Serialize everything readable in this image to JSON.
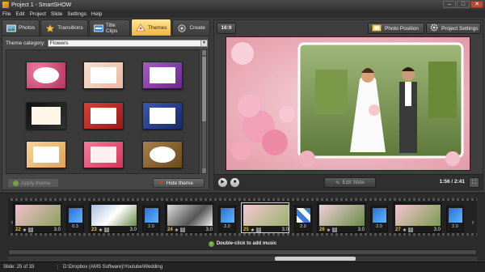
{
  "window": {
    "title": "Project 1 - SmartSHOW",
    "minimize": "–",
    "maximize": "□",
    "close": "✕"
  },
  "menu": [
    "File",
    "Edit",
    "Project",
    "Slide",
    "Settings",
    "Help"
  ],
  "tabs": [
    {
      "label": "Photos",
      "icon": "photos-icon"
    },
    {
      "label": "Transitions",
      "icon": "star-icon"
    },
    {
      "label": "Title Clips",
      "icon": "title-clips-icon"
    },
    {
      "label": "Themes",
      "icon": "themes-icon",
      "active": true
    },
    {
      "label": "Create",
      "icon": "create-icon"
    }
  ],
  "themes_panel": {
    "category_label": "Theme category:",
    "category_value": "Flowers",
    "apply_label": "Apply theme",
    "hide_label": "Hide theme",
    "thumbnails": [
      {
        "name": "pink-roses-oval",
        "bg": "#b3355a",
        "inner": "#ffffff"
      },
      {
        "name": "cream-flower-frame",
        "bg": "#f1d2c2",
        "inner": "#ffffff"
      },
      {
        "name": "purple-floral-frame",
        "bg": "#7a3b9a",
        "inner": "#ffffff"
      },
      {
        "name": "blossom-corner-frame",
        "bg": "#1e1e1e",
        "inner": "#fdf6e8"
      },
      {
        "name": "red-roses-frame",
        "bg": "#c0302e",
        "inner": "#ffffff"
      },
      {
        "name": "blue-floral-frame",
        "bg": "#2b3d8a",
        "inner": "#ffffff"
      },
      {
        "name": "peach-flowers-frame",
        "bg": "#f0c48a",
        "inner": "#ffffff"
      },
      {
        "name": "pink-lily-frame",
        "bg": "#e6547c",
        "inner": "#fff0f0"
      },
      {
        "name": "golden-oval-frame",
        "bg": "#8a6a3a",
        "inner": "#ffffff"
      }
    ]
  },
  "preview": {
    "aspect_label": "16:9",
    "photo_position_label": "Photo Position",
    "project_settings_label": "Project Settings",
    "edit_slide_label": "Edit Slide",
    "time": "1:56 / 2:41"
  },
  "timeline": {
    "slides": [
      {
        "num": "22",
        "duration": "3.0"
      },
      {
        "num": "23",
        "duration": "3.0"
      },
      {
        "num": "24",
        "duration": "3.0"
      },
      {
        "num": "25",
        "duration": "3.0"
      },
      {
        "num": "26",
        "duration": "3.0"
      },
      {
        "num": "27",
        "duration": "3.0"
      }
    ],
    "transitions": [
      "0.3",
      "2.0",
      "2.0",
      "2.0",
      "2.0",
      "2.0"
    ],
    "music_hint": "Double-click to add music"
  },
  "status": {
    "slide": "Slide: 25 of 33",
    "path": "D:\\Dropbox (AMS Software)\\Youtube\\Wedding"
  },
  "colors": {
    "accent_tab": "#f2b43d",
    "number": "#f0c040"
  }
}
